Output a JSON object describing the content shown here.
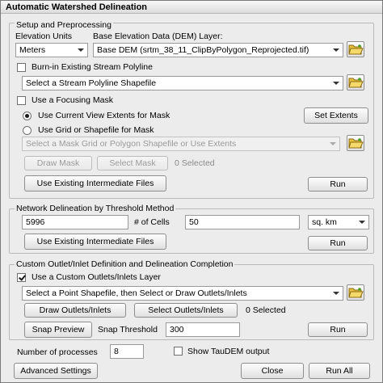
{
  "window": {
    "title": "Automatic Watershed Delineation"
  },
  "setup": {
    "group_label": "Setup and Preprocessing",
    "elevation_units_label": "Elevation Units",
    "elevation_units_value": "Meters",
    "dem_label": "Base Elevation Data (DEM) Layer:",
    "dem_value": "Base DEM (srtm_38_11_ClipByPolygon_Reprojected.tif)",
    "burn_in_label": "Burn-in Existing Stream Polyline",
    "stream_placeholder": "Select a Stream Polyline Shapefile",
    "focusing_mask_label": "Use a Focusing Mask",
    "current_extents_label": "Use Current View Extents for Mask",
    "set_extents_button": "Set Extents",
    "grid_shapefile_label": "Use Grid or Shapefile for Mask",
    "mask_placeholder": "Select a Mask Grid or Polygon Shapefile or Use Extents",
    "draw_mask_button": "Draw Mask",
    "select_mask_button": "Select Mask",
    "selected_count": "0 Selected",
    "existing_files_button": "Use Existing Intermediate Files",
    "run_button": "Run"
  },
  "network": {
    "group_label": "Network Delineation by Threshold Method",
    "threshold_value": "5996",
    "cells_label": "# of Cells",
    "area_value": "50",
    "unit_value": "sq. km",
    "existing_files_button": "Use Existing Intermediate Files",
    "run_button": "Run"
  },
  "outlet": {
    "group_label": "Custom Outlet/Inlet Definition and Delineation Completion",
    "custom_layer_label": "Use a Custom Outlets/Inlets Layer",
    "point_placeholder": "Select a Point Shapefile, then Select or Draw Outlets/Inlets",
    "draw_button": "Draw Outlets/Inlets",
    "select_button": "Select Outlets/Inlets",
    "selected_count": "0 Selected",
    "snap_preview_button": "Snap Preview",
    "snap_threshold_label": "Snap Threshold",
    "snap_threshold_value": "300",
    "run_button": "Run"
  },
  "footer": {
    "processes_label": "Number of processes",
    "processes_value": "8",
    "taudem_label": "Show TauDEM output",
    "advanced_button": "Advanced Settings",
    "close_button": "Close",
    "run_all_button": "Run All"
  },
  "icons": {
    "folder": "folder-open-icon",
    "dropdown": "chevron-down-icon"
  }
}
